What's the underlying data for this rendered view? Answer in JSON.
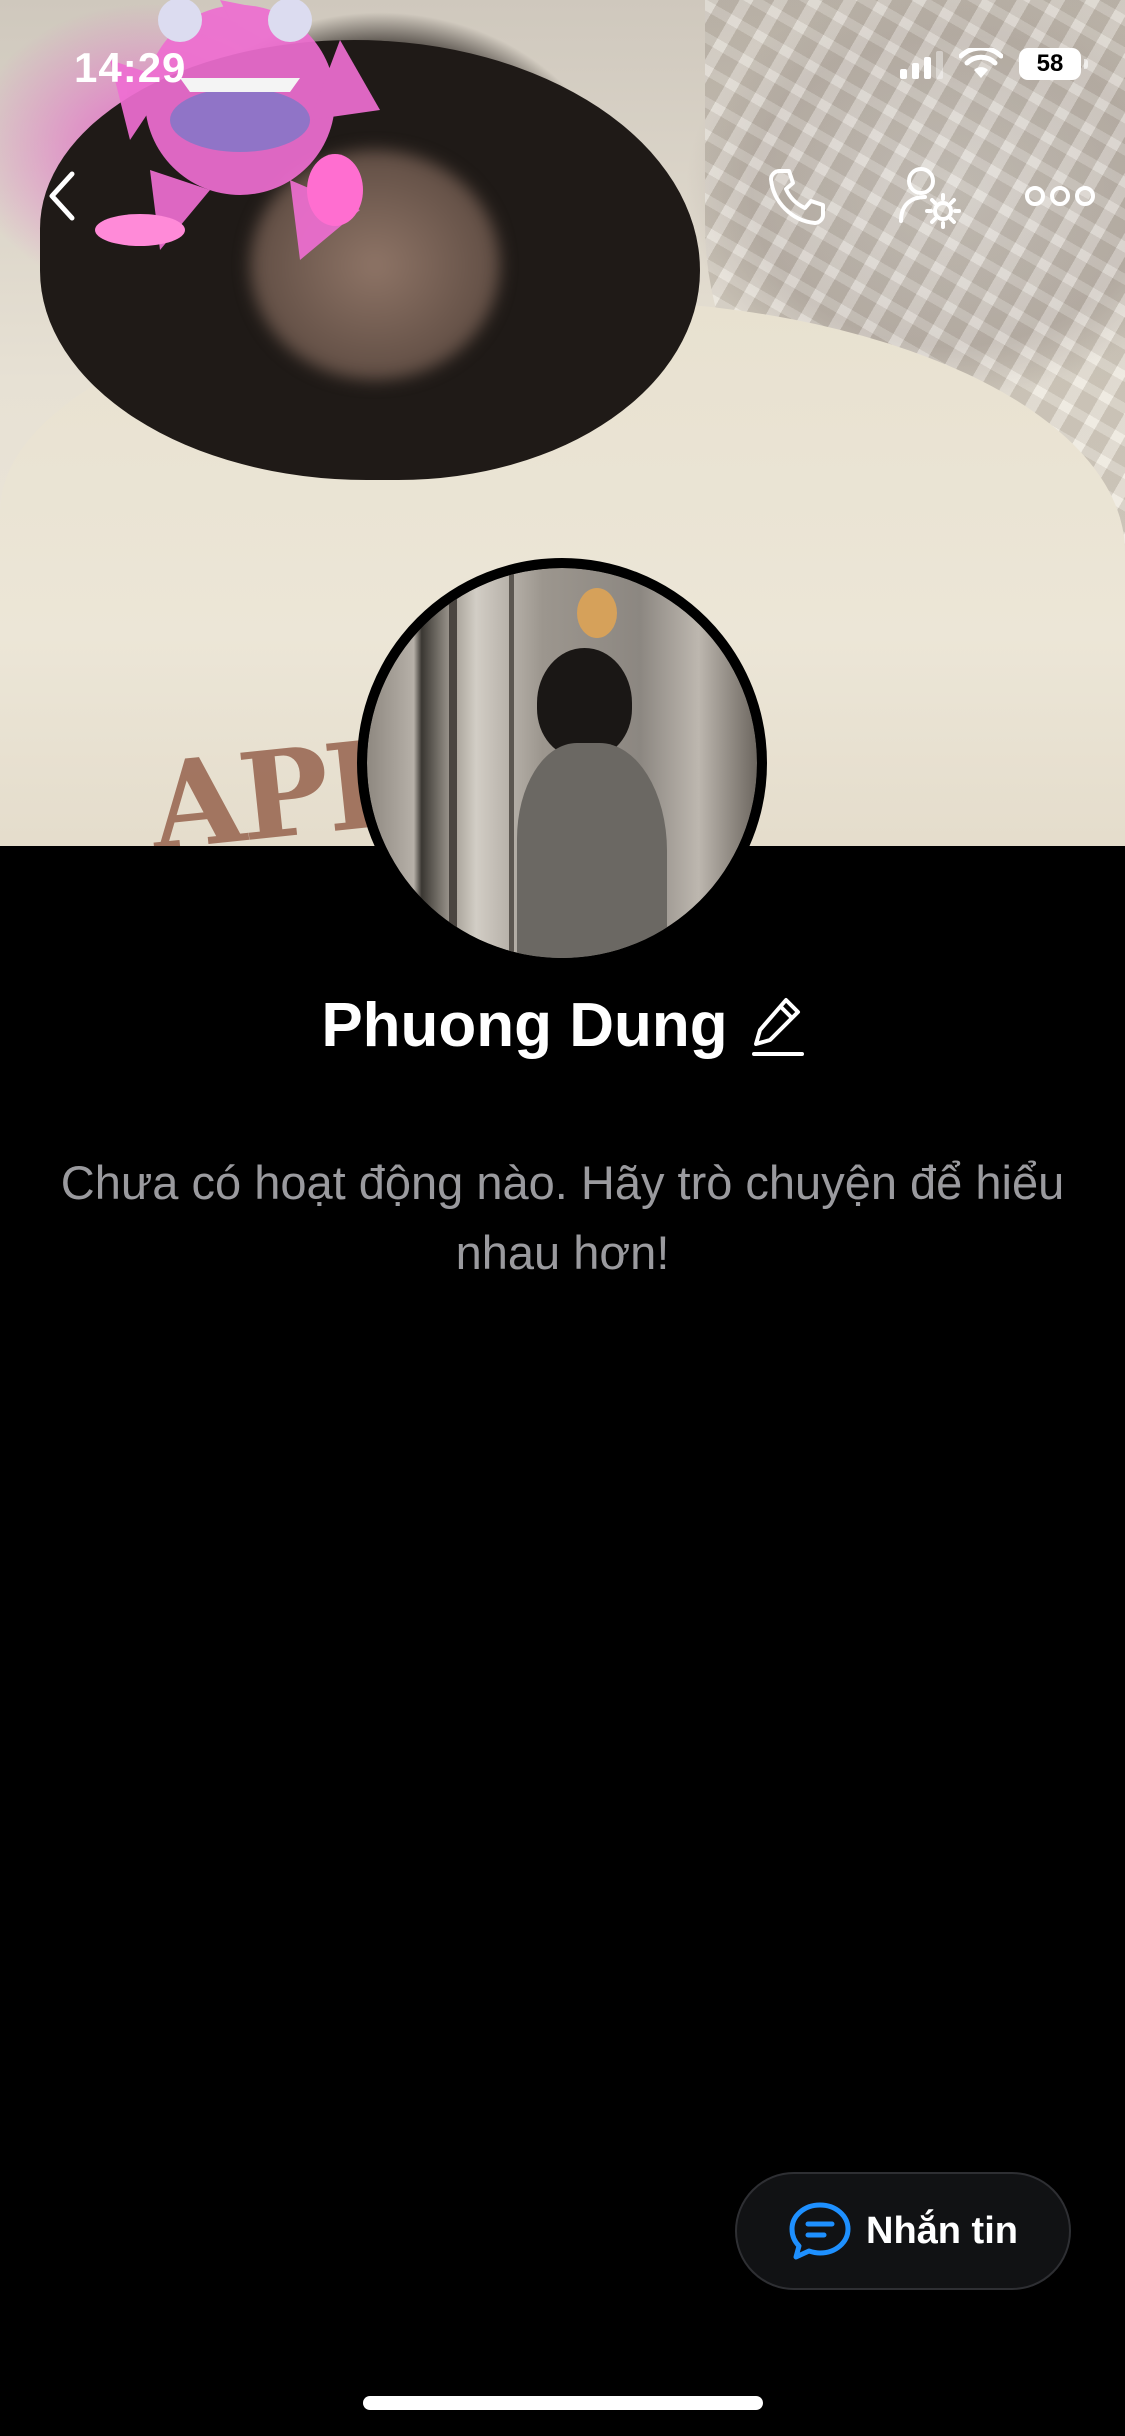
{
  "status_bar": {
    "time": "14:29",
    "battery": "58"
  },
  "nav": {
    "icons": [
      "back-chevron-icon",
      "phone-icon",
      "user-settings-icon",
      "more-icon"
    ]
  },
  "profile": {
    "name": "Phuong Dung",
    "empty_message": "Chưa có hoạt động nào. Hãy trò chuyện để hiểu nhau hơn!"
  },
  "cover": {
    "text": "APPL"
  },
  "actions": {
    "message_label": "Nhắn tin"
  },
  "colors": {
    "accent": "#1e90ff",
    "background": "#000000",
    "muted_text": "#9a9a9e"
  }
}
